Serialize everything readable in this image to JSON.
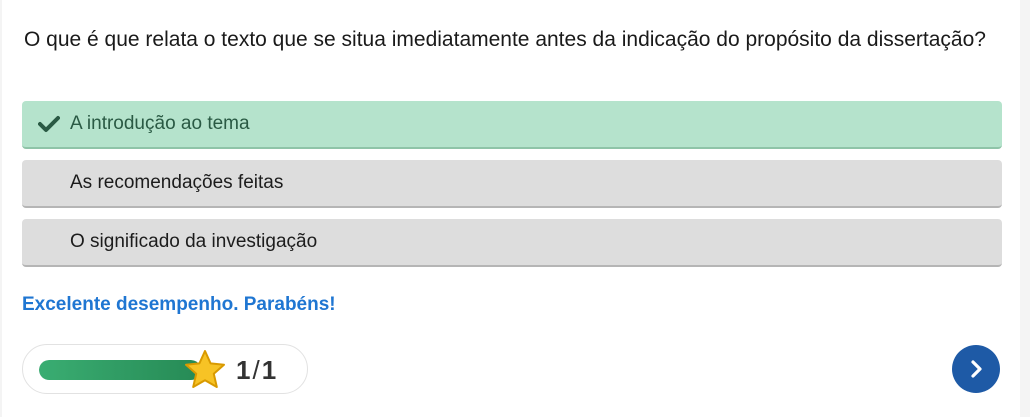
{
  "question": {
    "text": "O que é que relata o texto que se situa imediatamente antes da indicação do propósito da dissertação?"
  },
  "options": [
    {
      "label": "A introdução ao tema",
      "state": "correct",
      "icon": "check-icon"
    },
    {
      "label": "As recomendações feitas",
      "state": "neutral"
    },
    {
      "label": "O significado da investigação",
      "state": "neutral"
    }
  ],
  "feedback": {
    "text": "Excelente desempenho. Parabéns!",
    "color": "#1f76d2"
  },
  "progress": {
    "fraction": 1.0,
    "current": "1",
    "separator": "/",
    "total": "1",
    "icon": "star-icon"
  },
  "navigation": {
    "next_icon": "chevron-right-icon"
  },
  "colors": {
    "correct_bg": "#b5e3cc",
    "neutral_bg": "#dddddd",
    "progress_fill": "#2e9a62",
    "star": "#f7c325",
    "next_button": "#1e5aa6"
  }
}
